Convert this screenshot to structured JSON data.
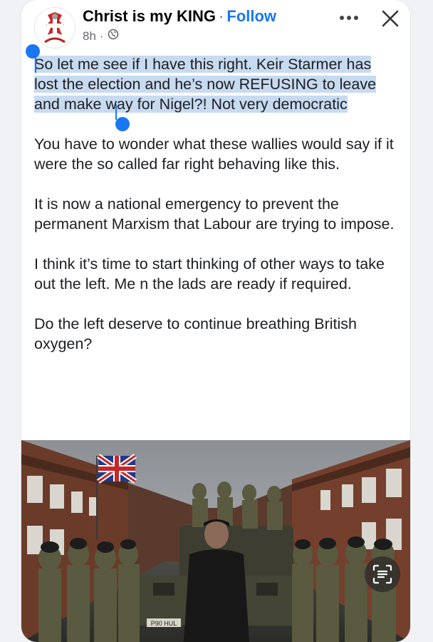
{
  "post": {
    "author": "Christ is my KING",
    "separator": "·",
    "follow_label": "Follow",
    "time": "8h",
    "meta_separator": "·",
    "privacy_icon": "globe-icon",
    "paragraphs": [
      "So let me see if I have this right. Keir Starmer has lost the election and he’s now REFUSING to leave and make way for Nigel?! Not very democratic",
      "You have to wonder what these wallies would say if it were the so called far right behaving like this.",
      "It is now a national emergency to prevent the permanent Marxism that Labour are trying to impose.",
      "I think it’s time to start thinking of other ways to take out the left. Me n the lads are ready if required.",
      "Do the left deserve to continue breathing British oxygen?"
    ]
  },
  "selection": {
    "paragraph": 0,
    "color": "#c7daf0",
    "handle_color": "#1877f2"
  },
  "photo": {
    "plate": "P90 HUL"
  },
  "icons": {
    "more": "more-horizontal-icon",
    "close": "close-icon",
    "lens": "visual-lookup-icon"
  },
  "colors": {
    "follow": "#1877f2",
    "meta": "#65676b",
    "background": "#f0f2f5"
  }
}
